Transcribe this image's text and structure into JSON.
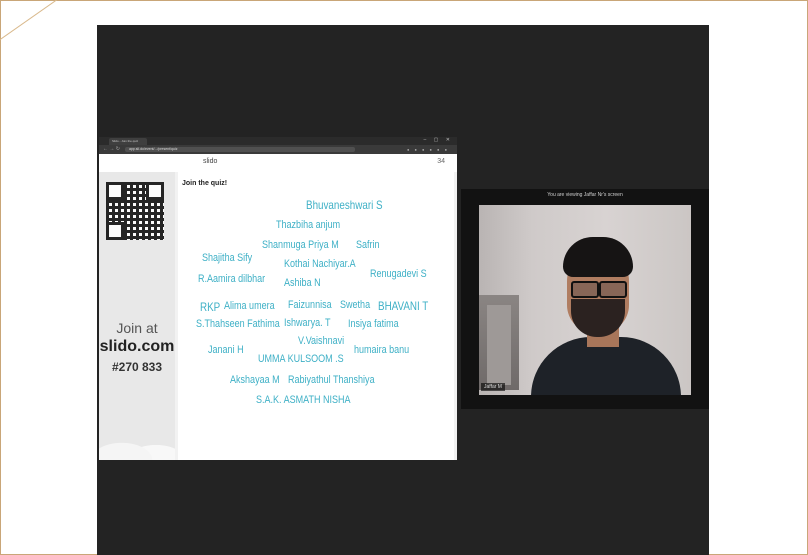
{
  "browser": {
    "tab_label": "Slido - Join the quiz",
    "url": "app.sli.do/event/.../present/quiz"
  },
  "slido": {
    "logo": "slido",
    "count": "34",
    "join_at": "Join at",
    "join_url": "slido.com",
    "join_code": "#270 833",
    "quiz_title": "Join the quiz!",
    "names": [
      "Bhuvaneshwari S",
      "Thazbiha anjum",
      "Shanmuga Priya M",
      "Safrin",
      "Shajitha Sify",
      "Kothai Nachiyar.A",
      "R.Aamira dilbhar",
      "Renugadevi S",
      "Ashiba N",
      "RKP",
      "Alima umera",
      "Faizunnisa",
      "Swetha",
      "BHAVANI T",
      "S.Thahseen Fathima",
      "Ishwarya. T",
      "Insiya fatima",
      "V.Vaishnavi",
      "Janani H",
      "humaira banu",
      "UMMA KULSOOM .S",
      "Akshayaa M",
      "Rabiyathul Thanshiya",
      "S.A.K. ASMATH NISHA"
    ]
  },
  "camera": {
    "title": "You are viewing Jaffar Nr's screen",
    "participant": "Jaffar M"
  },
  "colors": {
    "meeting_bg": "#232323",
    "word_color": "#3eb0c6",
    "frame_border": "#c9a678"
  }
}
